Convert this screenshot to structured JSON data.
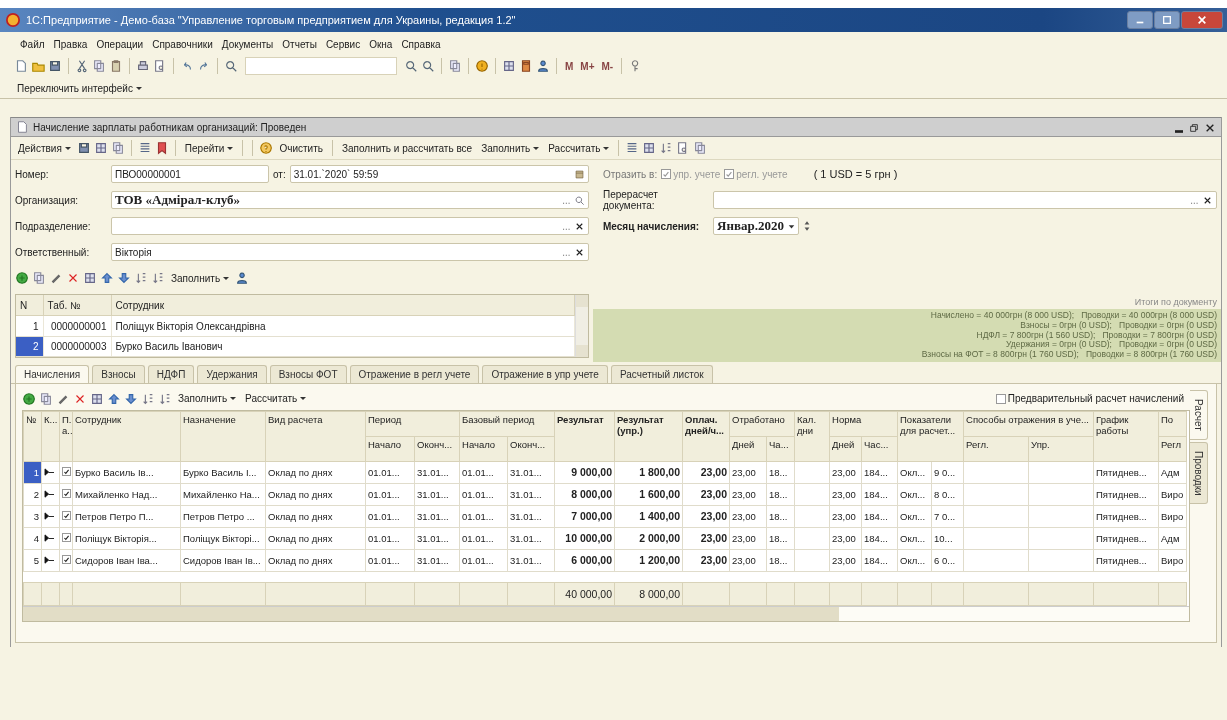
{
  "window": {
    "title": "1С:Предприятие - Демо-база \"Управление торговым предприятием для Украины, редакция 1.2\""
  },
  "menu": [
    "Файл",
    "Правка",
    "Операции",
    "Справочники",
    "Документы",
    "Отчеты",
    "Сервис",
    "Окна",
    "Справка"
  ],
  "toolbar": {
    "memory_buttons": [
      "M",
      "M+",
      "M-"
    ]
  },
  "interface_switch": "Переключить интерфейс",
  "document": {
    "title": "Начисление зарплаты работникам организаций: Проведен",
    "toolbar": [
      {
        "label": "Действия",
        "dropdown": true
      },
      {
        "label": "Перейти",
        "dropdown": true
      },
      {
        "label": "Очистить",
        "dropdown": false
      },
      {
        "label": "Заполнить и рассчитать все",
        "dropdown": false
      },
      {
        "label": "Заполнить",
        "dropdown": true
      },
      {
        "label": "Рассчитать",
        "dropdown": true
      }
    ],
    "number": {
      "label": "Номер:",
      "value": "ПВО00000001",
      "date_label": "от:",
      "date": "31.01.`2020` 59:59"
    },
    "organization": {
      "label": "Организация:",
      "value": "ТОВ «Адмірал-клуб»"
    },
    "subdivision": {
      "label": "Подразделение:"
    },
    "responsible": {
      "label": "Ответственный:",
      "value": "Вікторія"
    },
    "reflect": {
      "label": "Отразить в:",
      "options": [
        {
          "label": "упр. учете",
          "checked": true,
          "disabled": true
        },
        {
          "label": "регл. учете",
          "checked": true,
          "disabled": true
        }
      ],
      "rate": "( 1 USD = 5 грн )"
    },
    "recalc": {
      "label": "Перерасчет документа:"
    },
    "month": {
      "label": "Месяц начисления:",
      "value": "Январ.2020"
    },
    "totals": {
      "title": "Итоги по документу",
      "lines": [
        "Начислено = 40 000грн (8 000 USD);   Проводки = 40 000грн (8 000 USD)",
        "Взносы = 0грн (0 USD);   Проводки = 0грн (0 USD)",
        "НДФЛ = 7 800грн (1 560 USD);   Проводки = 7 800грн (0 USD)",
        "Удержания = 0грн (0 USD);   Проводки = 0грн (0 USD)",
        "Взносы на ФОТ = 8 800грн (1 760 USD);   Проводки = 8 800грн (1 760 USD)"
      ]
    },
    "employees": {
      "fill_button": "Заполнить",
      "columns": [
        "N",
        "Таб. №",
        "Сотрудник"
      ],
      "rows": [
        {
          "n": "1",
          "tab_no": "0000000001",
          "name": "Поліщук Вікторія Олександрівна",
          "selected": false
        },
        {
          "n": "2",
          "tab_no": "0000000003",
          "name": "Бурко Василь Іванович",
          "selected": true
        }
      ]
    },
    "tabs": [
      {
        "label": "Начисления",
        "selected": true
      },
      {
        "label": "Взносы",
        "selected": false
      },
      {
        "label": "НДФП",
        "selected": false
      },
      {
        "label": "Удержания",
        "selected": false
      },
      {
        "label": "Взносы ФОТ",
        "selected": false
      },
      {
        "label": "Отражение в регл учете",
        "selected": false
      },
      {
        "label": "Отражение в упр учете",
        "selected": false
      },
      {
        "label": "Расчетный листок",
        "selected": false
      }
    ],
    "grid": {
      "fill_button": "Заполнить",
      "calc_button": "Рассчитать",
      "preliminary": {
        "label": "Предварительный расчет начислений",
        "checked": false
      },
      "columns": [
        {
          "label": "№"
        },
        {
          "label": "К..."
        },
        {
          "label": "П. а.."
        },
        {
          "label": "Сотрудник"
        },
        {
          "label": "Назначение"
        },
        {
          "label": "Вид расчета"
        },
        {
          "label": "Период",
          "children": [
            "Начало",
            "Оконч..."
          ]
        },
        {
          "label": "Базовый период",
          "children": [
            "Начало",
            "Оконч..."
          ]
        },
        {
          "label": "Результат",
          "emphasis": true
        },
        {
          "label": "Результат (упр.)",
          "emphasis": true
        },
        {
          "label": "Оплач. дней/ч...",
          "emphasis": true
        },
        {
          "label": "Отработано",
          "children": [
            "Дней",
            "Ча..."
          ]
        },
        {
          "label": "Кал. дни"
        },
        {
          "label": "Норма",
          "children": [
            "Дней",
            "Час..."
          ]
        },
        {
          "label": "Показатели для расчет...",
          "kind": "pair"
        },
        {
          "label": "Способы отражения в уче...",
          "children": [
            "Регл.",
            "Упр."
          ]
        },
        {
          "label": "График работы"
        },
        {
          "label": "По",
          "children": [
            "Регл"
          ]
        }
      ],
      "rows": [
        {
          "n": "1",
          "selected": true,
          "included": true,
          "employee": "Бурко Василь Ів...",
          "purpose": "Бурко Василь І...",
          "calc_type": "Оклад по днях",
          "period_start": "01.01...",
          "period_end": "31.01...",
          "base_start": "01.01...",
          "base_end": "31.01...",
          "result": "9 000,00",
          "result_mgmt": "1 800,00",
          "paid": "23,00",
          "worked_days": "23,00",
          "worked_hours": "18...",
          "norm_days": "23,00",
          "norm_hours": "184...",
          "indicator": "Окл...",
          "indicator_value": "9 0...",
          "schedule": "Пятиднев...",
          "po_regl": "Адм"
        },
        {
          "n": "2",
          "selected": false,
          "included": true,
          "employee": "Михайленко Над...",
          "purpose": "Михайленко На...",
          "calc_type": "Оклад по днях",
          "period_start": "01.01...",
          "period_end": "31.01...",
          "base_start": "01.01...",
          "base_end": "31.01...",
          "result": "8 000,00",
          "result_mgmt": "1 600,00",
          "paid": "23,00",
          "worked_days": "23,00",
          "worked_hours": "18...",
          "norm_days": "23,00",
          "norm_hours": "184...",
          "indicator": "Окл...",
          "indicator_value": "8 0...",
          "schedule": "Пятиднев...",
          "po_regl": "Виро"
        },
        {
          "n": "3",
          "selected": false,
          "included": true,
          "employee": "Петров Петро П...",
          "purpose": "Петров Петро ...",
          "calc_type": "Оклад по днях",
          "period_start": "01.01...",
          "period_end": "31.01...",
          "base_start": "01.01...",
          "base_end": "31.01...",
          "result": "7 000,00",
          "result_mgmt": "1 400,00",
          "paid": "23,00",
          "worked_days": "23,00",
          "worked_hours": "18...",
          "norm_days": "23,00",
          "norm_hours": "184...",
          "indicator": "Окл...",
          "indicator_value": "7 0...",
          "schedule": "Пятиднев...",
          "po_regl": "Виро"
        },
        {
          "n": "4",
          "selected": false,
          "included": true,
          "employee": "Поліщук Вікторія...",
          "purpose": "Поліщук Вікторі...",
          "calc_type": "Оклад по днях",
          "period_start": "01.01...",
          "period_end": "31.01...",
          "base_start": "01.01...",
          "base_end": "31.01...",
          "result": "10 000,00",
          "result_mgmt": "2 000,00",
          "paid": "23,00",
          "worked_days": "23,00",
          "worked_hours": "18...",
          "norm_days": "23,00",
          "norm_hours": "184...",
          "indicator": "Окл...",
          "indicator_value": "10...",
          "schedule": "Пятиднев...",
          "po_regl": "Адм"
        },
        {
          "n": "5",
          "selected": false,
          "included": true,
          "employee": "Сидоров Іван Іва...",
          "purpose": "Сидоров Іван Ів...",
          "calc_type": "Оклад по днях",
          "period_start": "01.01...",
          "period_end": "31.01...",
          "base_start": "01.01...",
          "base_end": "31.01...",
          "result": "6 000,00",
          "result_mgmt": "1 200,00",
          "paid": "23,00",
          "worked_days": "23,00",
          "worked_hours": "18...",
          "norm_days": "23,00",
          "norm_hours": "184...",
          "indicator": "Окл...",
          "indicator_value": "6 0...",
          "schedule": "Пятиднев...",
          "po_regl": "Виро"
        }
      ],
      "totals": {
        "result": "40 000,00",
        "result_mgmt": "8 000,00"
      },
      "side_tabs": [
        {
          "label": "Расчет",
          "selected": true
        },
        {
          "label": "Проводки",
          "selected": false
        }
      ]
    }
  }
}
